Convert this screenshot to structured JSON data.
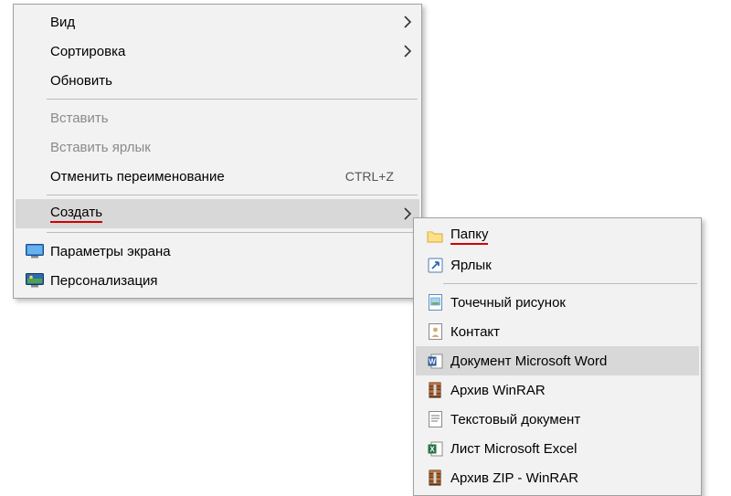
{
  "main_menu": {
    "view": "Вид",
    "sort": "Сортировка",
    "refresh": "Обновить",
    "paste": "Вставить",
    "paste_shortcut": "Вставить ярлык",
    "undo_rename": "Отменить переименование",
    "undo_rename_shortcut": "CTRL+Z",
    "create": "Создать",
    "display_settings": "Параметры экрана",
    "personalize": "Персонализация"
  },
  "sub_menu": {
    "folder": "Папку",
    "shortcut": "Ярлык",
    "bitmap": "Точечный рисунок",
    "contact": "Контакт",
    "word_doc": "Документ Microsoft Word",
    "rar": "Архив WinRAR",
    "text_doc": "Текстовый документ",
    "excel": "Лист Microsoft Excel",
    "zip": "Архив ZIP - WinRAR"
  }
}
